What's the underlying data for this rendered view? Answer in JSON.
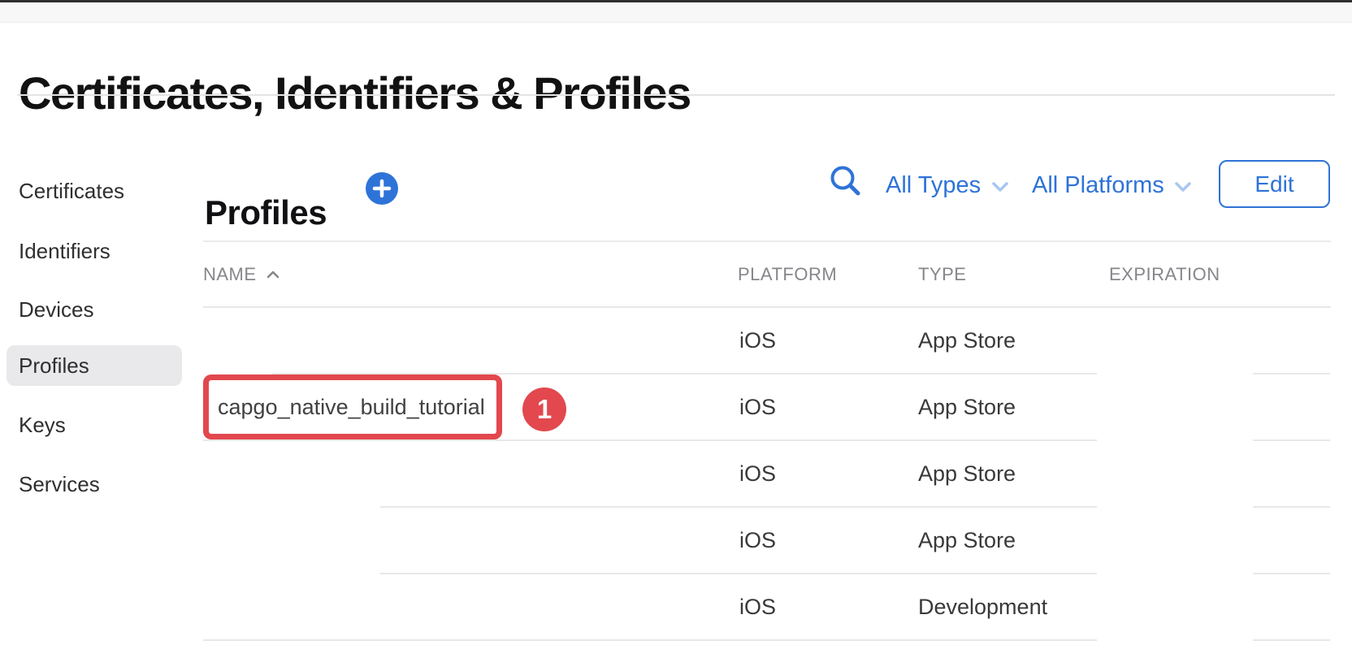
{
  "page": {
    "title": "Certificates, Identifiers & Profiles"
  },
  "sidebar": {
    "items": [
      {
        "label": "Certificates",
        "selected": false
      },
      {
        "label": "Identifiers",
        "selected": false
      },
      {
        "label": "Devices",
        "selected": false
      },
      {
        "label": "Profiles",
        "selected": true
      },
      {
        "label": "Keys",
        "selected": false
      },
      {
        "label": "Services",
        "selected": false
      }
    ]
  },
  "toolbar": {
    "heading": "Profiles",
    "add_icon": "plus-circle",
    "search_icon": "magnifier",
    "filters": {
      "types_label": "All Types",
      "platforms_label": "All Platforms"
    },
    "edit_label": "Edit"
  },
  "table": {
    "columns": [
      {
        "label": "NAME",
        "sort": "ascending"
      },
      {
        "label": "PLATFORM"
      },
      {
        "label": "TYPE"
      },
      {
        "label": "EXPIRATION"
      }
    ],
    "rows": [
      {
        "name": "",
        "platform": "iOS",
        "type": "App Store",
        "expiration": ""
      },
      {
        "name": "capgo_native_build_tutorial",
        "platform": "iOS",
        "type": "App Store",
        "expiration": "",
        "annotated": true
      },
      {
        "name": "",
        "platform": "iOS",
        "type": "App Store",
        "expiration": ""
      },
      {
        "name": "",
        "platform": "iOS",
        "type": "App Store",
        "expiration": ""
      },
      {
        "name": "",
        "platform": "iOS",
        "type": "Development",
        "expiration": ""
      }
    ]
  },
  "annotation": {
    "badge_label": "1"
  },
  "colors": {
    "accent_blue": "#2e73d8",
    "chevron_blue": "#a9c7ef",
    "annotation_red": "#e2484e",
    "divider": "#e8e8e8",
    "header_text": "#86868b",
    "cell_text": "#39393b",
    "selected_item_bg": "#e9e9eb"
  }
}
